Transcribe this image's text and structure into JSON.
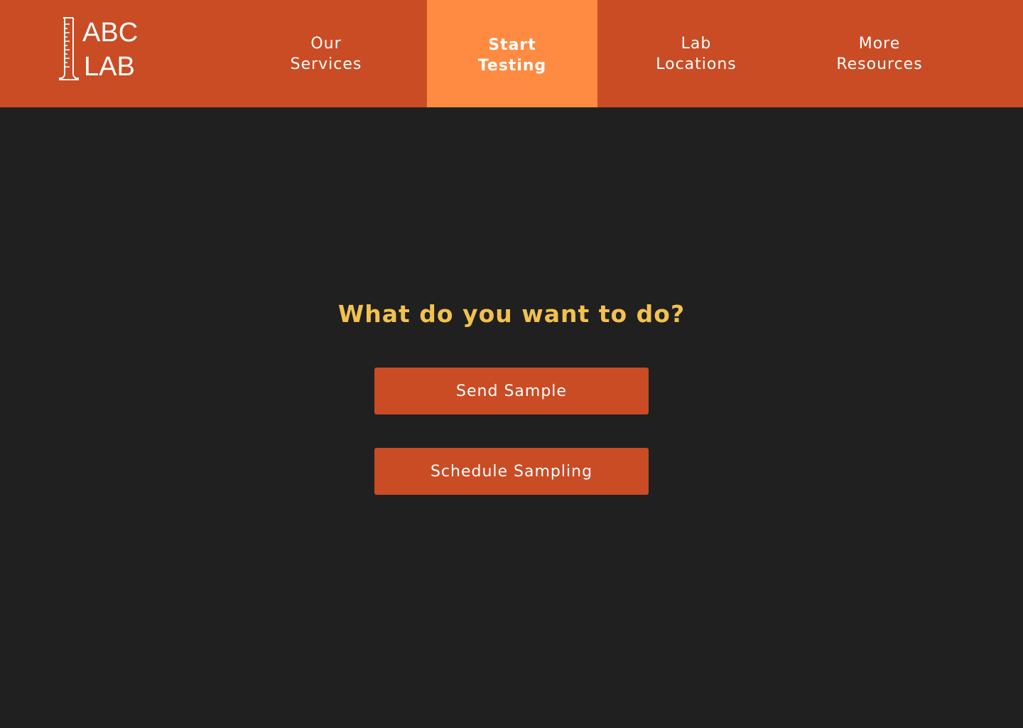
{
  "logo": {
    "line1": "ABC",
    "line2": "LAB",
    "icon": "graduated-cylinder-icon"
  },
  "nav": {
    "items": [
      {
        "label": "Our\nServices",
        "active": false
      },
      {
        "label": "Start\nTesting",
        "active": true
      },
      {
        "label": "Lab\nLocations",
        "active": false
      },
      {
        "label": "More\nResources",
        "active": false
      }
    ]
  },
  "main": {
    "prompt": "What do you want to do?",
    "actions": [
      {
        "label": "Send Sample"
      },
      {
        "label": "Schedule Sampling"
      }
    ]
  },
  "colors": {
    "header_bg": "#C94C25",
    "active_tab_bg": "#FF8A41",
    "page_bg": "#202020",
    "prompt_text": "#F2C14E",
    "button_bg": "#C94C25"
  }
}
